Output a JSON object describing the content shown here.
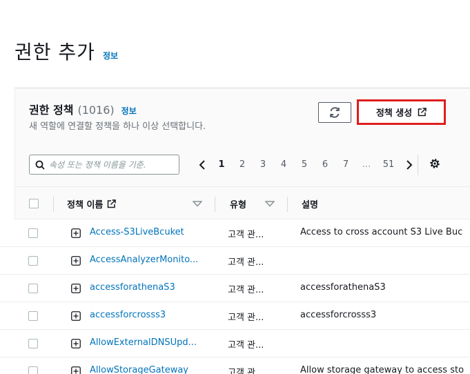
{
  "page": {
    "title": "권한 추가",
    "info": "정보"
  },
  "panel": {
    "title": "권한 정책",
    "count": "(1016)",
    "info": "정보",
    "description": "새 역할에 연결할 정책을 하나 이상 선택합니다.",
    "create_button": "정책 생성"
  },
  "search": {
    "placeholder": "속성 또는 정책 이름을 기준."
  },
  "pagination": {
    "pages": [
      "1",
      "2",
      "3",
      "4",
      "5",
      "6",
      "7"
    ],
    "ellipsis": "...",
    "last": "51",
    "current": "1"
  },
  "table": {
    "columns": [
      "정책 이름",
      "유형",
      "설명"
    ],
    "rows": [
      {
        "name": "Access-S3LiveBcuket",
        "type": "고객 관...",
        "desc": "Access to cross account S3 Live Buc"
      },
      {
        "name": "AccessAnalyzerMonito...",
        "type": "고객 관...",
        "desc": ""
      },
      {
        "name": "accessforathenaS3",
        "type": "고객 관...",
        "desc": "accessforathenaS3"
      },
      {
        "name": "accessforcrosss3",
        "type": "고객 관...",
        "desc": "accessforcrosss3"
      },
      {
        "name": "AllowExternalDNSUpd...",
        "type": "고객 관...",
        "desc": ""
      },
      {
        "name": "AllowStorageGateway",
        "type": "고객 관...",
        "desc": "Allow storage gateway to access  sto"
      }
    ]
  },
  "colors": {
    "link": "#0073bb",
    "highlight": "#e01d1d"
  }
}
